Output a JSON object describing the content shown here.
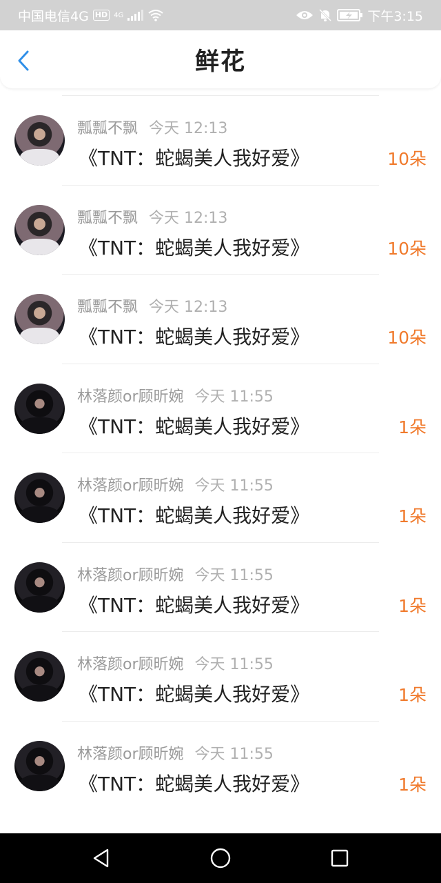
{
  "status_bar": {
    "carrier": "中国电信4G",
    "hd": "HD",
    "network": "4G",
    "time": "下午3:15",
    "icons": [
      "signal-icon",
      "wifi-icon",
      "eye-icon",
      "mute-icon",
      "battery-icon"
    ]
  },
  "header": {
    "title": "鲜花",
    "back_icon": "chevron-left-icon",
    "accent": "#2f8fe8"
  },
  "items": [
    {
      "user": "瓢瓢不飘",
      "time": "今天 12:13",
      "work": "《TNT：蛇蝎美人我好爱》",
      "count": "10朵",
      "avatar": "style-a"
    },
    {
      "user": "瓢瓢不飘",
      "time": "今天 12:13",
      "work": "《TNT：蛇蝎美人我好爱》",
      "count": "10朵",
      "avatar": "style-a"
    },
    {
      "user": "瓢瓢不飘",
      "time": "今天 12:13",
      "work": "《TNT：蛇蝎美人我好爱》",
      "count": "10朵",
      "avatar": "style-a"
    },
    {
      "user": "林落颜or顾昕婉",
      "time": "今天 11:55",
      "work": "《TNT：蛇蝎美人我好爱》",
      "count": "1朵",
      "avatar": "style-b"
    },
    {
      "user": "林落颜or顾昕婉",
      "time": "今天 11:55",
      "work": "《TNT：蛇蝎美人我好爱》",
      "count": "1朵",
      "avatar": "style-b"
    },
    {
      "user": "林落颜or顾昕婉",
      "time": "今天 11:55",
      "work": "《TNT：蛇蝎美人我好爱》",
      "count": "1朵",
      "avatar": "style-b"
    },
    {
      "user": "林落颜or顾昕婉",
      "time": "今天 11:55",
      "work": "《TNT：蛇蝎美人我好爱》",
      "count": "1朵",
      "avatar": "style-b"
    },
    {
      "user": "林落颜or顾昕婉",
      "time": "今天 11:55",
      "work": "《TNT：蛇蝎美人我好爱》",
      "count": "1朵",
      "avatar": "style-b"
    }
  ],
  "colors": {
    "count": "#f07a2c",
    "meta": "#9a9a9a",
    "title": "#222222"
  },
  "nav_bar": {
    "icons": [
      "back-triangle-icon",
      "home-circle-icon",
      "recents-square-icon"
    ]
  }
}
